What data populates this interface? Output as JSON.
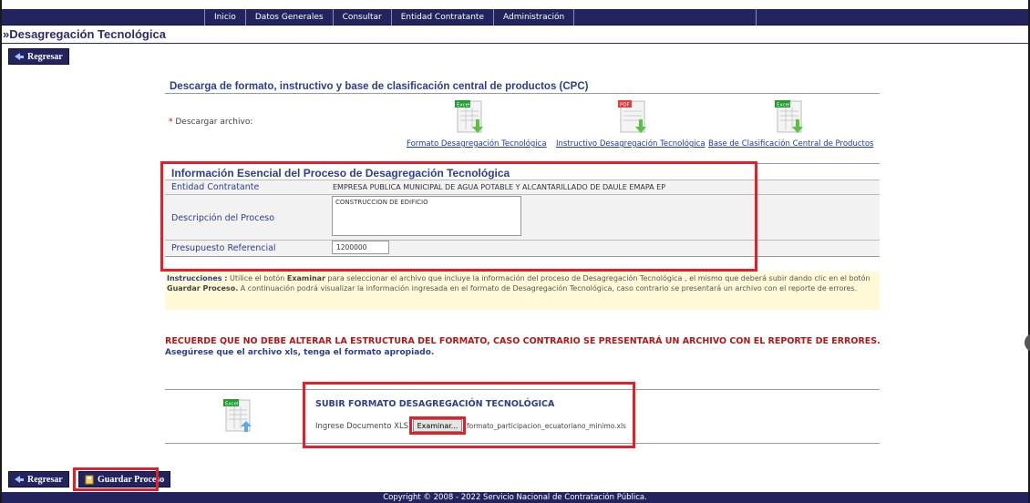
{
  "nav": {
    "items": [
      "Inicio",
      "Datos Generales",
      "Consultar",
      "Entidad Contratante",
      "Administración"
    ]
  },
  "page": {
    "title": "»Desagregación Tecnológica"
  },
  "buttons": {
    "back_label": "Regresar",
    "save_label": "Guardar Proceso"
  },
  "download": {
    "heading": "Descarga de formato, instructivo y base de clasificación central de productos (CPC)",
    "required_mark": "*",
    "label": "Descargar archivo:",
    "files": [
      {
        "badge": "Excel",
        "link": "Formato Desagregación Tecnológica",
        "color": "#1f9d2f"
      },
      {
        "badge": "PDF",
        "link": "Instructivo Desagregación Tecnológica",
        "color": "#e23b3b"
      },
      {
        "badge": "Excel",
        "link": "Base de Clasificación Central de Productos",
        "color": "#1f9d2f"
      }
    ]
  },
  "info": {
    "heading": "Información Esencial del Proceso de Desagregación Tecnológica",
    "entity_label": "Entidad Contratante",
    "entity_value": "EMPRESA PUBLICA MUNICIPAL DE AGUA POTABLE Y ALCANTARILLADO DE DAULE EMAPA EP",
    "description_label": "Descripción del Proceso",
    "description_value": "CONSTRUCCION DE EDIFICIO",
    "budget_label": "Presupuesto Referencial",
    "budget_value": "1200000"
  },
  "instructions": {
    "title": "Instrucciones :",
    "p1": " Utilice el botón ",
    "b1": "Examinar",
    "p2": " para seleccionar el archivo que incluye la información del proceso de Desagregación Tecnológica , el mismo que deberá subir dando clic en el botón ",
    "b2": "Guardar Proceso.",
    "p3": " A continuación podrá visualizar la información ingresada en el formato de Desagregación Tecnológica, caso contrario se presentará un archivo con el reporte de errores."
  },
  "warnings": {
    "line1": "RECUERDE QUE NO DEBE ALTERAR LA ESTRUCTURA DEL FORMATO, CASO CONTRARIO SE PRESENTARÁ UN ARCHIVO CON EL REPORTE DE ERRORES.",
    "line2": "Asegúrese que el archivo xls, tenga el formato apropiado."
  },
  "upload": {
    "badge": "Excel",
    "title": "SUBIR FORMATO DESAGREGACIÓN TECNOLÓGICA",
    "label": "Ingrese Documento XLS",
    "browse_label": "Examinar...",
    "file_name": "formato_participacion_ecuatoriano_minimo.xls"
  },
  "footer": {
    "text": "Copyright © 2008 - 2022 Servicio Nacional de Contratación Pública."
  },
  "colors": {
    "navy": "#23235e",
    "highlight": "#e3202a",
    "heading": "#2b3f8c",
    "warning": "#b01818"
  }
}
